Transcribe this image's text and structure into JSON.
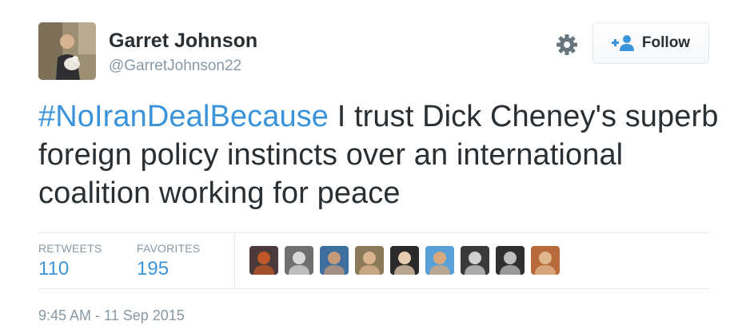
{
  "user": {
    "fullname": "Garret Johnson",
    "username": "@GarretJohnson22",
    "avatar_icon": "profile-photo"
  },
  "actions": {
    "settings_icon": "gear-icon",
    "follow_icon": "add-user-icon",
    "follow_label": "Follow"
  },
  "tweet": {
    "hashtag": "#NoIranDealBecause",
    "text": " I trust Dick Cheney's superb foreign policy instincts over an international coalition working for peace"
  },
  "stats": {
    "retweets_label": "RETWEETS",
    "retweets_count": "110",
    "favorites_label": "FAVORITES",
    "favorites_count": "195"
  },
  "favoriters": [
    {
      "icon": "user-avatar",
      "bg": "#4a3a3c",
      "fg": "#c0582a"
    },
    {
      "icon": "user-avatar",
      "bg": "#6f6f6f",
      "fg": "#d8d8d8"
    },
    {
      "icon": "user-avatar",
      "bg": "#3f6f9f",
      "fg": "#c49a7a"
    },
    {
      "icon": "user-avatar",
      "bg": "#8a7a5a",
      "fg": "#d9b48e"
    },
    {
      "icon": "user-avatar",
      "bg": "#2a2a2a",
      "fg": "#e6cdb0"
    },
    {
      "icon": "user-avatar",
      "bg": "#5aa0d8",
      "fg": "#d9a97e"
    },
    {
      "icon": "user-avatar",
      "bg": "#3a3a3a",
      "fg": "#cfcfcf"
    },
    {
      "icon": "user-avatar",
      "bg": "#2f2f2f",
      "fg": "#bdbdbd"
    },
    {
      "icon": "user-avatar",
      "bg": "#b86a3a",
      "fg": "#e0b890"
    }
  ],
  "timestamp": "9:45 AM - 11 Sep 2015",
  "colors": {
    "link": "#3b94d9",
    "text": "#292f33",
    "muted": "#8899a6",
    "border": "#e1e8ed"
  }
}
